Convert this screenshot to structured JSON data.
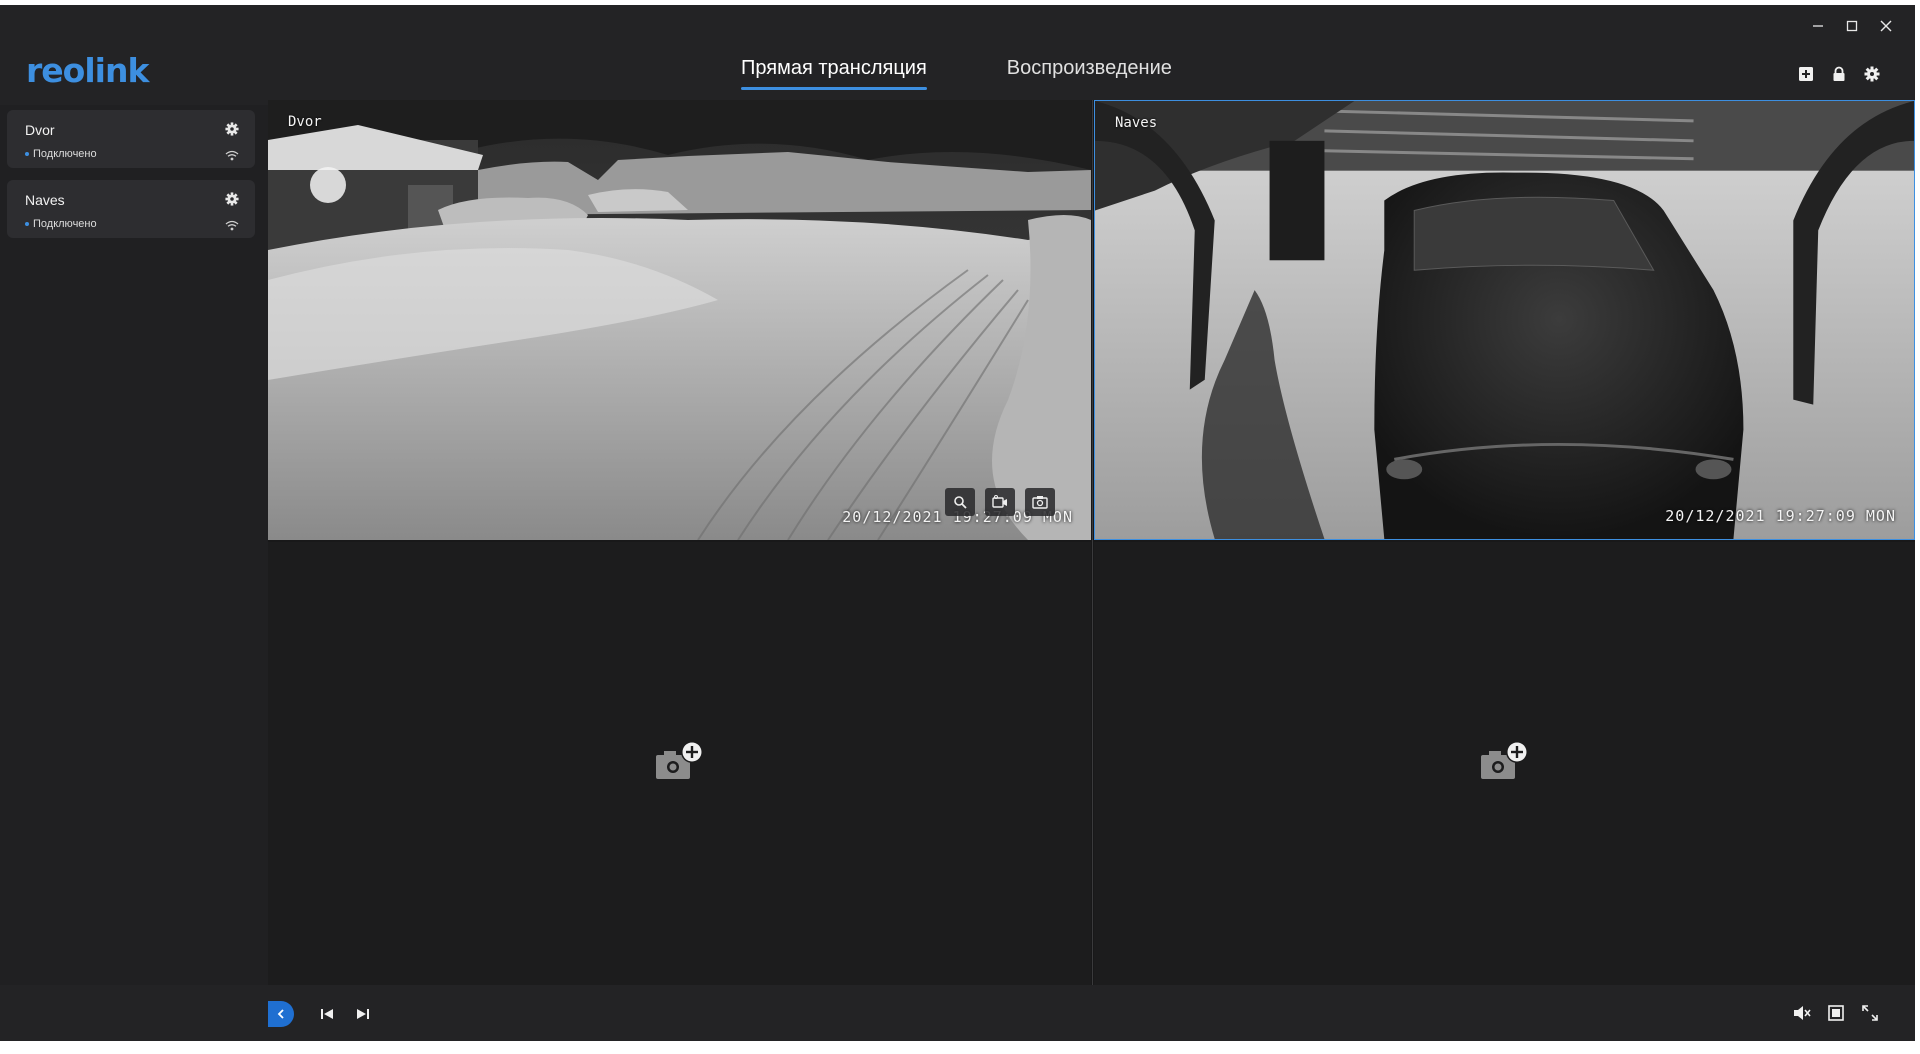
{
  "app": {
    "logo_text": "reolink",
    "accent_color": "#3d8fe0"
  },
  "window_controls": [
    "minimize-icon",
    "maximize-icon",
    "close-icon"
  ],
  "tabs": [
    {
      "label": "Прямая трансляция",
      "active": true
    },
    {
      "label": "Воспроизведение",
      "active": false
    }
  ],
  "top_actions": [
    "add-device-icon",
    "lock-icon",
    "settings-gear-icon"
  ],
  "sidebar": {
    "cameras": [
      {
        "name": "Dvor",
        "status": "Подключено"
      },
      {
        "name": "Naves",
        "status": "Подключено"
      }
    ]
  },
  "grid": {
    "feeds": [
      {
        "osd_name": "Dvor",
        "osd_time": "20/12/2021 19:27:09 MON",
        "selected": false
      },
      {
        "osd_name": "Naves",
        "osd_time": "20/12/2021 19:27:09 MON",
        "selected": true
      }
    ],
    "feed_overlay_buttons": [
      "zoom-icon",
      "record-icon",
      "snapshot-icon"
    ],
    "empty_slots": 2
  },
  "bottom_bar": {
    "left": [
      "collapse-sidebar-icon",
      "previous-icon",
      "next-icon"
    ],
    "right": [
      "mute-icon",
      "layout-icon",
      "fullscreen-icon"
    ]
  }
}
